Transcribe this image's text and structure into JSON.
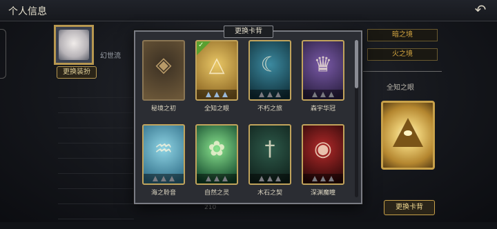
{
  "page": {
    "title": "个人信息"
  },
  "profile": {
    "change_frame_label": "更换装扮",
    "name_partial": "幻世流",
    "stats_value_partial": "210"
  },
  "right": {
    "tag1": "暗之境",
    "tag2": "火之境",
    "selected_title": "全知之眼",
    "change_back_label": "更换卡背"
  },
  "modal": {
    "title": "更换卡背",
    "cards": [
      {
        "label": "秘境之初",
        "selected": false,
        "stars": 0,
        "colors": [
          "#3b3023",
          "#6a5638"
        ]
      },
      {
        "label": "全知之眼",
        "selected": true,
        "stars": 3,
        "colors": [
          "#e9c766",
          "#8a6422"
        ]
      },
      {
        "label": "不朽之旅",
        "selected": false,
        "stars": 3,
        "colors": [
          "#3c8aa0",
          "#10303a"
        ]
      },
      {
        "label": "森宇华冠",
        "selected": false,
        "stars": 3,
        "colors": [
          "#7a5aa8",
          "#2a1f40"
        ]
      },
      {
        "label": "海之聆音",
        "selected": false,
        "stars": 3,
        "colors": [
          "#8fd4e4",
          "#2e6c86"
        ]
      },
      {
        "label": "自然之灵",
        "selected": false,
        "stars": 3,
        "colors": [
          "#8ae48e",
          "#10442a"
        ]
      },
      {
        "label": "木石之契",
        "selected": false,
        "stars": 3,
        "colors": [
          "#2e5a4a",
          "#10221c"
        ]
      },
      {
        "label": "深渊魔瞳",
        "selected": false,
        "stars": 3,
        "colors": [
          "#b42a2a",
          "#2a0808"
        ]
      }
    ]
  },
  "icons": {
    "back": "back-arrow-icon",
    "check": "check-icon"
  }
}
